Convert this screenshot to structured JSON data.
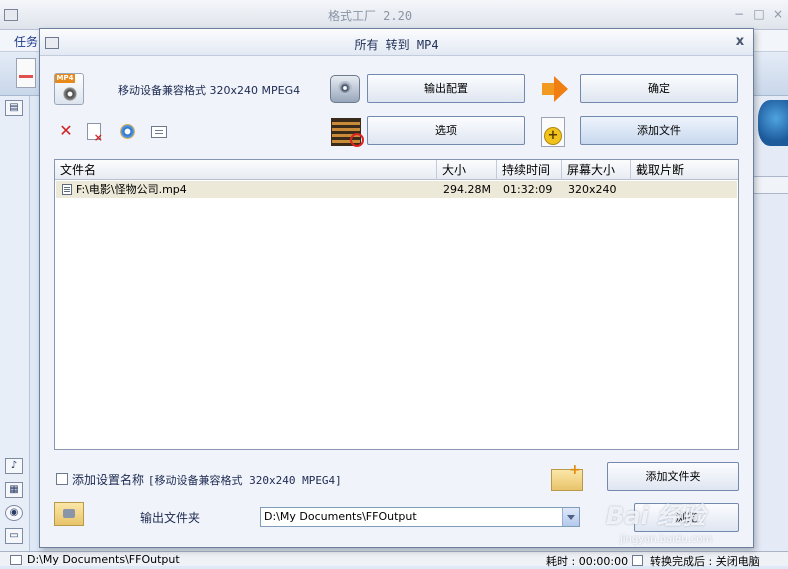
{
  "background_window": {
    "title": "格式工厂 2.20",
    "menu_first": "任务",
    "side_icons": [
      "settings-icon",
      "music-icon",
      "picture-icon",
      "disc-icon",
      "more-icon"
    ],
    "status_path": "D:\\My Documents\\FFOutput",
    "status_time": "耗时 : 00:00:00",
    "status_after_convert": "转换完成后 : 关闭电脑"
  },
  "dialog": {
    "title": "所有 转到 MP4",
    "close_glyph": "x",
    "profile_icon_badge": "MP4",
    "profile_text": "移动设备兼容格式 320x240 MPEG4",
    "buttons": {
      "output_config": "输出配置",
      "ok": "确定",
      "options": "选项",
      "add_file": "添加文件",
      "add_folder": "添加文件夹",
      "browse": "浏览"
    },
    "list": {
      "columns": [
        "文件名",
        "大小",
        "持续时间",
        "屏幕大小",
        "截取片断"
      ],
      "rows": [
        {
          "filename": "F:\\电影\\怪物公司.mp4",
          "size": "294.28M",
          "duration": "01:32:09",
          "screen_size": "320x240",
          "clip": ""
        }
      ]
    },
    "add_setting_name_label": "添加设置名称",
    "add_setting_name_value": "[移动设备兼容格式 320x240 MPEG4]",
    "output_folder_label": "输出文件夹",
    "output_folder_value": "D:\\My Documents\\FFOutput"
  },
  "watermark": {
    "logo": "Bai 经验",
    "url": "jingyan.baidu.com"
  },
  "colors": {
    "dialog_bg": "#f0f3f9",
    "title_text": "#22325a",
    "selected_row": "#ece9d8",
    "delete_red": "#d12020",
    "arrow_orange": "#f07e10"
  }
}
